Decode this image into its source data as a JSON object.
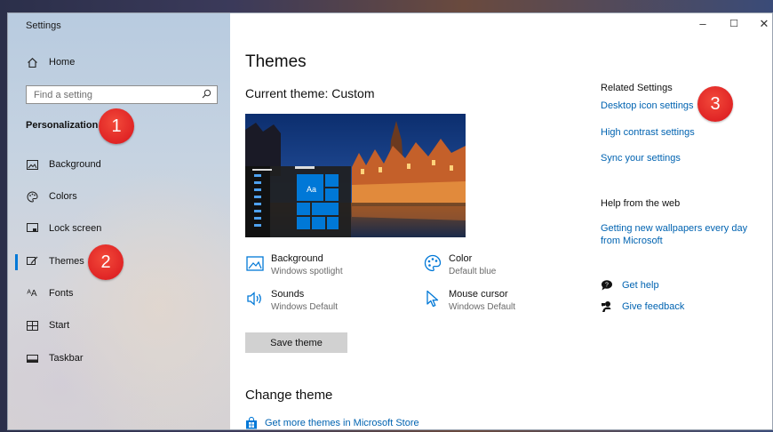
{
  "window": {
    "title": "Settings"
  },
  "controls": {
    "minimize": "–",
    "maximize": "☐",
    "close": "✕"
  },
  "sidebar": {
    "home": "Home",
    "search_placeholder": "Find a setting",
    "section": "Personalization",
    "items": [
      {
        "label": "Background",
        "icon": "image-icon"
      },
      {
        "label": "Colors",
        "icon": "palette-icon"
      },
      {
        "label": "Lock screen",
        "icon": "lock-screen-icon"
      },
      {
        "label": "Themes",
        "icon": "brush-icon",
        "active": true
      },
      {
        "label": "Fonts",
        "icon": "font-icon"
      },
      {
        "label": "Start",
        "icon": "start-icon"
      },
      {
        "label": "Taskbar",
        "icon": "taskbar-icon"
      }
    ]
  },
  "main": {
    "title": "Themes",
    "current_theme": "Current theme: Custom",
    "preview_sample": "Aa",
    "properties": [
      {
        "label": "Background",
        "value": "Windows spotlight",
        "icon": "image-icon"
      },
      {
        "label": "Color",
        "value": "Default blue",
        "icon": "palette-icon"
      },
      {
        "label": "Sounds",
        "value": "Windows Default",
        "icon": "speaker-icon"
      },
      {
        "label": "Mouse cursor",
        "value": "Windows Default",
        "icon": "cursor-icon"
      }
    ],
    "save_button": "Save theme",
    "change_theme": "Change theme",
    "store_link": "Get more themes in Microsoft Store"
  },
  "related": {
    "heading": "Related Settings",
    "links": [
      "Desktop icon settings",
      "High contrast settings",
      "Sync your settings"
    ],
    "help_heading": "Help from the web",
    "help_link_line1": "Getting new wallpapers every day",
    "help_link_line2": "from Microsoft",
    "get_help": "Get help",
    "give_feedback": "Give feedback"
  },
  "badges": [
    "1",
    "2",
    "3"
  ],
  "colors": {
    "accent": "#0078d7",
    "link": "#0063b1",
    "badge": "#e01e24"
  }
}
